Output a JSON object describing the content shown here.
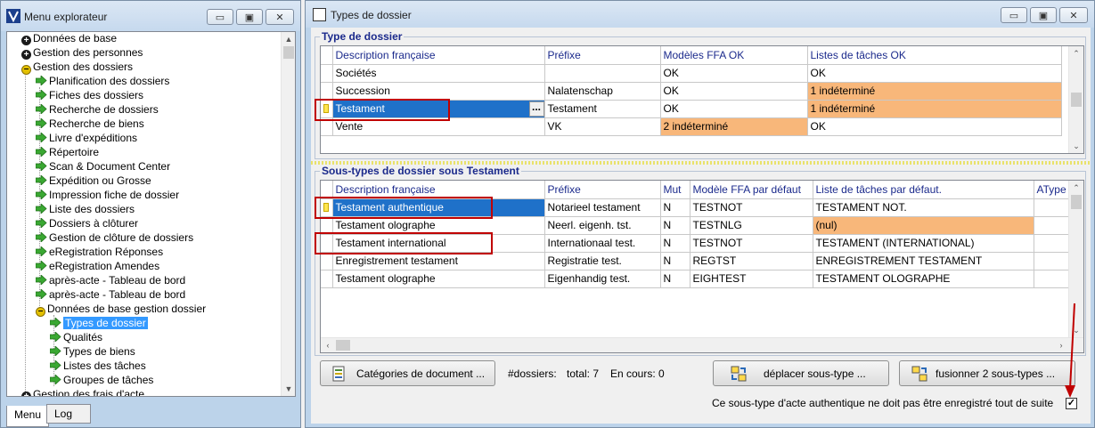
{
  "left_window": {
    "title": "Menu explorateur",
    "buttons": {
      "minimize": "▭",
      "maximize": "▣",
      "close": "✕"
    },
    "tree": [
      {
        "label": "Données de base",
        "icon": "plus-icon"
      },
      {
        "label": "Gestion des personnes",
        "icon": "plus-icon"
      },
      {
        "label": "Gestion des dossiers",
        "icon": "minus-icon"
      },
      {
        "label": "Planification des dossiers",
        "icon": "arrow-icon"
      },
      {
        "label": "Fiches des dossiers",
        "icon": "arrow-icon"
      },
      {
        "label": "Recherche de dossiers",
        "icon": "arrow-icon"
      },
      {
        "label": "Recherche de biens",
        "icon": "arrow-icon"
      },
      {
        "label": "Livre d'expéditions",
        "icon": "arrow-icon"
      },
      {
        "label": "Répertoire",
        "icon": "arrow-icon"
      },
      {
        "label": "Scan & Document Center",
        "icon": "arrow-icon"
      },
      {
        "label": "Expédition ou Grosse",
        "icon": "arrow-icon"
      },
      {
        "label": "Impression fiche de dossier",
        "icon": "arrow-icon"
      },
      {
        "label": "Liste des dossiers",
        "icon": "arrow-icon"
      },
      {
        "label": "Dossiers à clôturer",
        "icon": "arrow-icon"
      },
      {
        "label": "Gestion de clôture de dossiers",
        "icon": "arrow-icon"
      },
      {
        "label": "eRegistration Réponses",
        "icon": "arrow-icon"
      },
      {
        "label": "eRegistration Amendes",
        "icon": "arrow-icon"
      },
      {
        "label": "après-acte - Tableau de bord",
        "icon": "arrow-icon"
      },
      {
        "label": "après-acte - Tableau de bord",
        "icon": "arrow-icon"
      },
      {
        "label": "Données de base gestion dossier",
        "icon": "minus-icon"
      },
      {
        "label": "Types de dossier",
        "icon": "arrow-icon",
        "selected": true
      },
      {
        "label": "Qualités",
        "icon": "arrow-icon"
      },
      {
        "label": "Types de biens",
        "icon": "arrow-icon"
      },
      {
        "label": "Listes des tâches",
        "icon": "arrow-icon"
      },
      {
        "label": "Groupes de tâches",
        "icon": "arrow-icon"
      },
      {
        "label": "Gestion des frais d'acte",
        "icon": "plus-icon"
      }
    ],
    "tabs": [
      "Menu",
      "Log"
    ]
  },
  "right_window": {
    "title": "Types de dossier",
    "buttons": {
      "minimize": "▭",
      "maximize": "▣",
      "close": "✕"
    },
    "group1": {
      "label": "Type de dossier",
      "columns": [
        "Description française",
        "Préfixe",
        "Modèles FFA OK",
        "Listes de tâches OK"
      ],
      "rows": [
        [
          "Sociétés",
          "",
          "OK",
          "OK"
        ],
        [
          "Succession",
          "Nalatenschap",
          "OK",
          "1 indéterminé"
        ],
        [
          "Testament",
          "Testament",
          "OK",
          "1 indéterminé"
        ],
        [
          "Vente",
          "VK",
          "2 indéterminé",
          "OK"
        ]
      ],
      "ellipsis": "..."
    },
    "group2": {
      "label": "Sous-types de dossier sous Testament",
      "columns": [
        "Description française",
        "Préfixe",
        "Mut",
        "Modèle FFA par défaut",
        "Liste de tâches par défaut.",
        "AType"
      ],
      "rows": [
        [
          "Testament authentique",
          "Notarieel testament",
          "N",
          "TESTNOT",
          "TESTAMENT NOT.",
          ""
        ],
        [
          "Testament olographe",
          "Neerl. eigenh. tst.",
          "N",
          "TESTNLG",
          "(nul)",
          ""
        ],
        [
          "Testament international",
          "Internationaal test.",
          "N",
          "TESTNOT",
          "TESTAMENT (INTERNATIONAL)",
          ""
        ],
        [
          "Enregistrement testament",
          "Registratie test.",
          "N",
          "REGTST",
          "ENREGISTREMENT TESTAMENT",
          ""
        ],
        [
          "Testament olographe",
          "Eigenhandig test.",
          "N",
          "EIGHTEST",
          "TESTAMENT OLOGRAPHE",
          ""
        ]
      ]
    },
    "buttons_row": {
      "categories": "Catégories de document ...",
      "dossiers_label": "#dossiers:",
      "total": "total: 7",
      "en_cours": "En cours: 0",
      "move": "déplacer sous-type ...",
      "merge": "fusionner 2 sous-types ..."
    },
    "checkbox_label": "Ce sous-type d'acte authentique ne doit pas être enregistré tout de suite",
    "checkbox_checked": "✓"
  }
}
